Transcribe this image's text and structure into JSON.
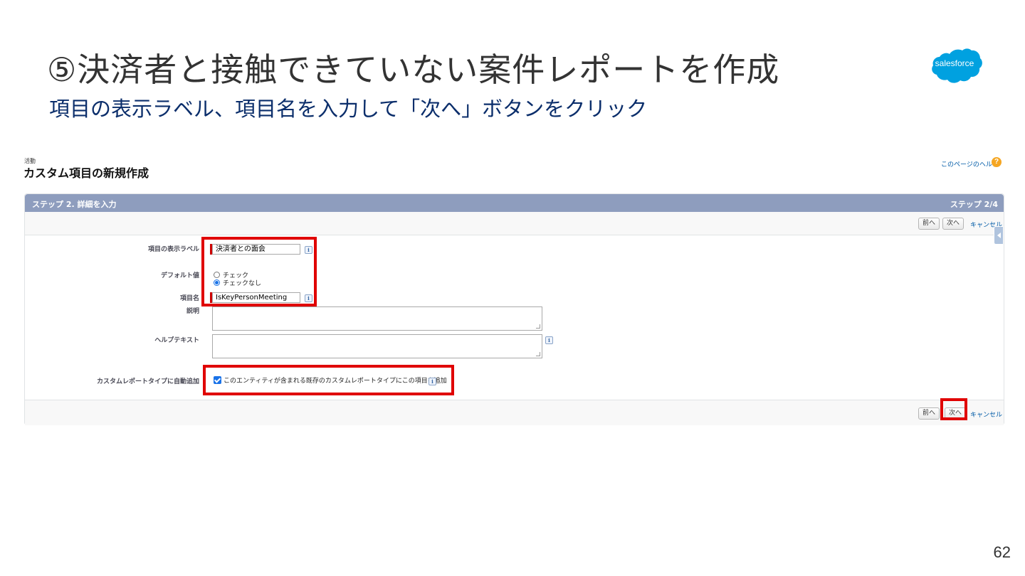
{
  "slide": {
    "title": "⑤決済者と接触できていない案件レポートを作成",
    "subtitle": "項目の表示ラベル、項目名を入力して「次へ」ボタンをクリック",
    "logo_text": "salesforce",
    "page_number": "62"
  },
  "colors": {
    "highlight": "#e00000",
    "header_bar": "#8e9dbe",
    "link": "#015ba7",
    "title_text": "#333333",
    "subtitle_text": "#0b2e6b"
  },
  "sf": {
    "kicker": "活動",
    "heading": "カスタム項目の新規作成",
    "help_link": "このページのヘルプ",
    "help_icon": "?",
    "step_label": "ステップ 2. 詳細を入力",
    "step_count": "ステップ 2/4",
    "prev_label": "前へ",
    "next_label": "次へ",
    "cancel_label": "キャンセル",
    "form": {
      "field_label_label": "項目の表示ラベル",
      "field_label_value": "決済者との面会",
      "default_label": "デフォルト値",
      "option_checked": "チェック",
      "option_unchecked": "チェックなし",
      "selected_option": "チェックなし",
      "field_name_label": "項目名",
      "field_name_value": "IsKeyPersonMeeting",
      "description_label": "説明",
      "help_text_label": "ヘルプテキスト",
      "auto_add_label": "カスタムレポートタイプに自動追加",
      "auto_add_text": "このエンティティが含まれる既存のカスタムレポートタイプにこの項目を追加",
      "auto_add_checked": true,
      "info_glyph": "i"
    }
  }
}
